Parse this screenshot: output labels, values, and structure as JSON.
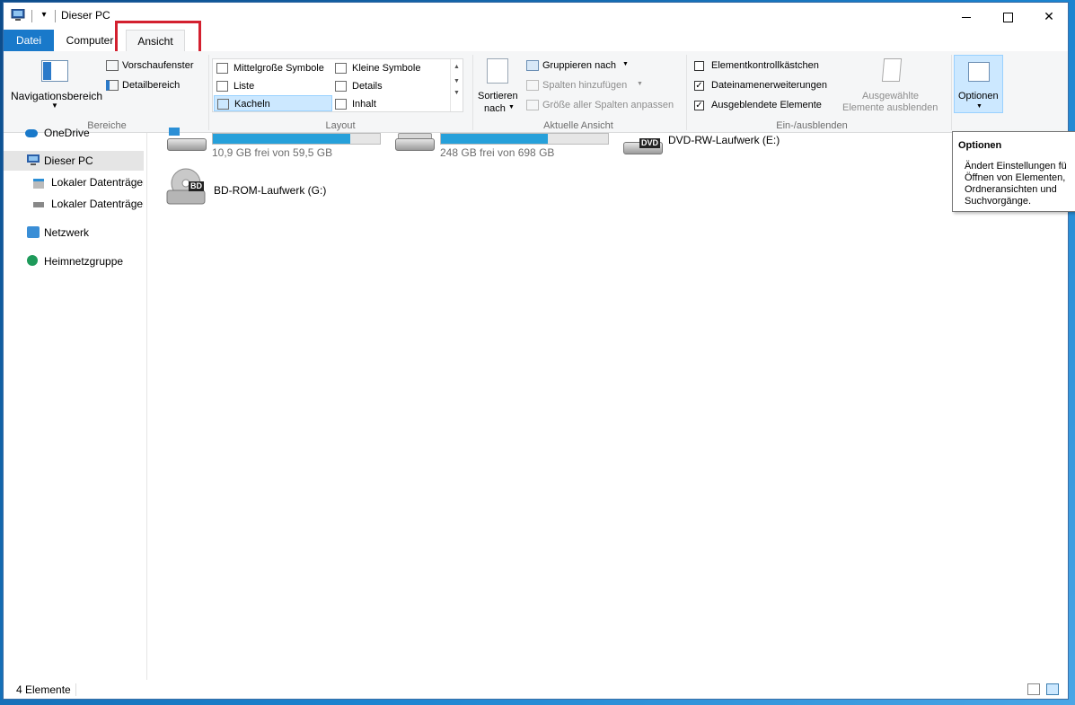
{
  "window": {
    "title": "Dieser PC",
    "controls": {
      "minimize": "",
      "maximize": "",
      "close": "✕"
    }
  },
  "tabs": {
    "file": "Datei",
    "computer": "Computer",
    "view": "Ansicht"
  },
  "ribbon": {
    "panes": {
      "navigation_pane": "Navigationsbereich",
      "preview_pane": "Vorschaufenster",
      "details_pane": "Detailbereich",
      "group_label": "Bereiche"
    },
    "layout": {
      "items": [
        "Mittelgroße Symbole",
        "Kleine Symbole",
        "Liste",
        "Details",
        "Kacheln",
        "Inhalt"
      ],
      "selected": "Kacheln",
      "group_label": "Layout"
    },
    "current_view": {
      "sort_by_line1": "Sortieren",
      "sort_by_line2": "nach",
      "group_by": "Gruppieren nach",
      "add_columns": "Spalten hinzufügen",
      "size_columns": "Größe aller Spalten anpassen",
      "group_label": "Aktuelle Ansicht"
    },
    "show_hide": {
      "item_checkboxes": "Elementkontrollkästchen",
      "item_checkboxes_checked": false,
      "file_extensions": "Dateinamenerweiterungen",
      "file_extensions_checked": true,
      "hidden_items": "Ausgeblendete Elemente",
      "hidden_items_checked": true,
      "hide_selected_line1": "Ausgewählte",
      "hide_selected_line2": "Elemente ausblenden",
      "group_label": "Ein-/ausblenden"
    },
    "options": {
      "label": "Optionen"
    }
  },
  "navigation": {
    "items": [
      {
        "label": "OneDrive",
        "icon": "onedrive-icon"
      },
      {
        "label": "Dieser PC",
        "icon": "computer-icon",
        "selected": true
      },
      {
        "label": "Lokaler Datenträger",
        "icon": "windows-drive-icon"
      },
      {
        "label": "Lokaler Datenträger",
        "icon": "drive-icon"
      },
      {
        "label": "Netzwerk",
        "icon": "network-icon"
      },
      {
        "label": "Heimnetzgruppe",
        "icon": "homegroup-icon"
      }
    ]
  },
  "drives": [
    {
      "name": "",
      "free_text": "10,9 GB frei von 59,5 GB",
      "fill": 0.82
    },
    {
      "name": "",
      "free_text": "248 GB frei von 698 GB",
      "fill": 0.64
    },
    {
      "name": "DVD-RW-Laufwerk (E:)",
      "badge": "DVD"
    },
    {
      "name": "BD-ROM-Laufwerk (G:)",
      "badge": "BD"
    }
  ],
  "tooltip": {
    "title": "Optionen",
    "body": "Ändert Einstellungen fü\nÖffnen von Elementen,\nOrdneransichten und\nSuchvorgänge."
  },
  "status": {
    "count": "4 Elemente"
  },
  "colors": {
    "accent": "#1979ca",
    "selection": "#cce8ff",
    "highlight_box": "#d3202f",
    "bar_fill": "#26a0da"
  }
}
